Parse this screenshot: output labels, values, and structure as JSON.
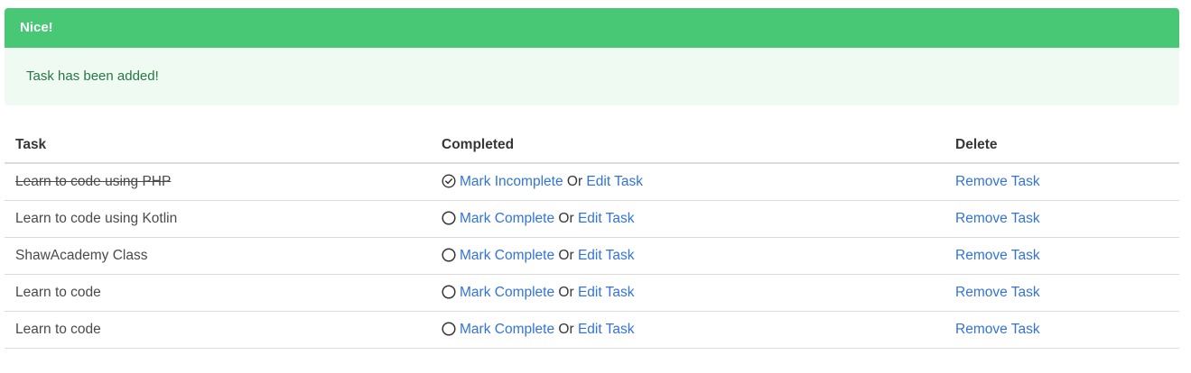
{
  "notification": {
    "title": "Nice!",
    "message": "Task has been added!",
    "header_color": "#48c774",
    "body_color": "#effaf3"
  },
  "table": {
    "headers": {
      "task": "Task",
      "completed": "Completed",
      "delete": "Delete"
    },
    "rows": [
      {
        "task": "Learn to code using PHP",
        "done": true,
        "status_icon": "check-circle-icon",
        "mark_label": "Mark Incomplete",
        "or_text": "Or",
        "edit_label": "Edit Task",
        "remove_label": "Remove Task"
      },
      {
        "task": "Learn to code using Kotlin",
        "done": false,
        "status_icon": "circle-icon",
        "mark_label": "Mark Complete",
        "or_text": "Or",
        "edit_label": "Edit Task",
        "remove_label": "Remove Task"
      },
      {
        "task": "ShawAcademy Class",
        "done": false,
        "status_icon": "circle-icon",
        "mark_label": "Mark Complete",
        "or_text": "Or",
        "edit_label": "Edit Task",
        "remove_label": "Remove Task"
      },
      {
        "task": "Learn to code",
        "done": false,
        "status_icon": "circle-icon",
        "mark_label": "Mark Complete",
        "or_text": "Or",
        "edit_label": "Edit Task",
        "remove_label": "Remove Task"
      },
      {
        "task": "Learn to code",
        "done": false,
        "status_icon": "circle-icon",
        "mark_label": "Mark Complete",
        "or_text": "Or",
        "edit_label": "Edit Task",
        "remove_label": "Remove Task"
      }
    ]
  },
  "colors": {
    "link": "#3273dc",
    "border": "#dbdbdb"
  }
}
